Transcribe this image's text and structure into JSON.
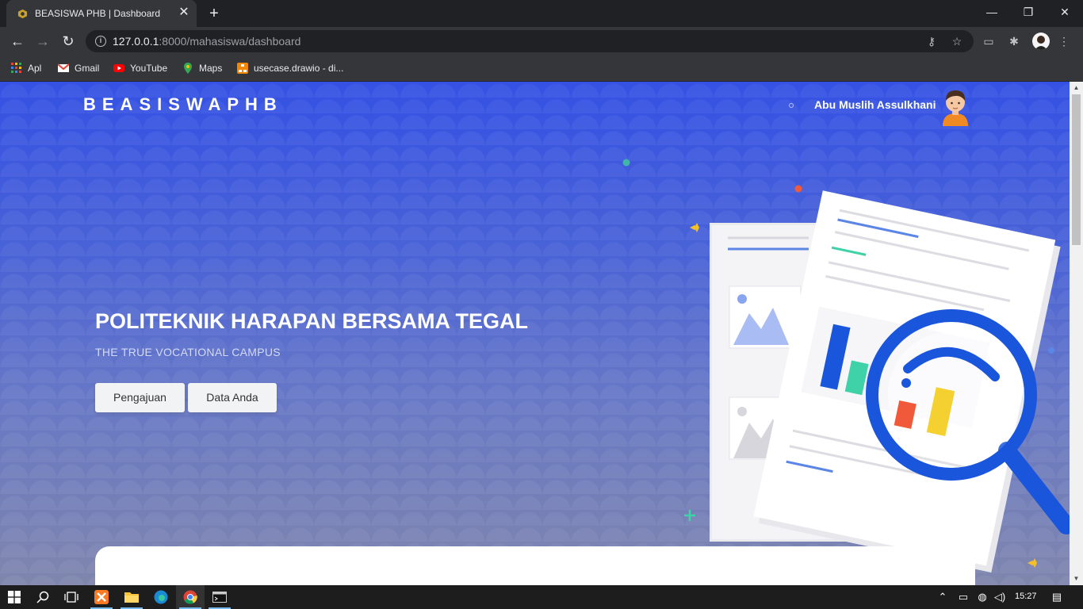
{
  "browser": {
    "tab_title": "BEASISWA PHB | Dashboard",
    "tab_close": "✕",
    "new_tab": "+",
    "url_host": "127.0.0.1",
    "url_path": ":8000/mahasiswa/dashboard",
    "window_controls": {
      "minimize": "—",
      "restore": "❐",
      "close": "✕"
    },
    "bookmarks": [
      {
        "label": "Apl",
        "icon": "apps-grid-icon"
      },
      {
        "label": "Gmail",
        "icon": "gmail-icon"
      },
      {
        "label": "YouTube",
        "icon": "youtube-icon"
      },
      {
        "label": "Maps",
        "icon": "maps-icon"
      },
      {
        "label": "usecase.drawio - di...",
        "icon": "drawio-icon"
      }
    ]
  },
  "page": {
    "brand": "BEASISWAPHB",
    "user_name": "Abu Muslih Assulkhani",
    "hero_title": "POLITEKNIK HARAPAN BERSAMA TEGAL",
    "hero_subtitle": "THE TRUE VOCATIONAL CAMPUS",
    "buttons": {
      "pengajuan": "Pengajuan",
      "data_anda": "Data Anda"
    }
  },
  "taskbar": {
    "clock": "15:27",
    "apps": [
      "windows-start-icon",
      "search-icon",
      "task-view-icon",
      "xampp-icon",
      "file-explorer-icon",
      "edge-icon",
      "chrome-icon",
      "terminal-icon"
    ]
  },
  "colors": {
    "accent_blue": "#1a56db",
    "hero_top": "#3451e4",
    "hero_bottom": "#7f86ad",
    "chrome_dark": "#202124",
    "chrome_toolbar": "#35363a"
  }
}
